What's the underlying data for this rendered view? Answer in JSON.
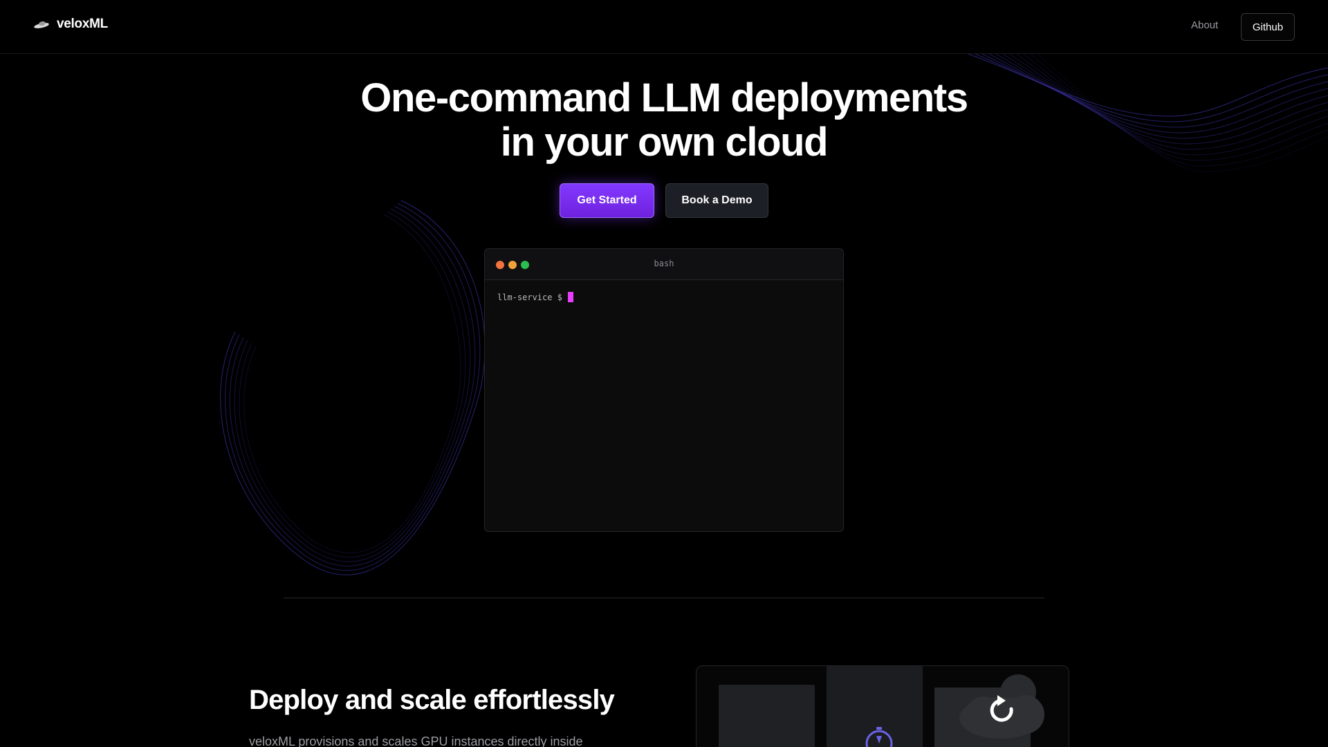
{
  "brand": {
    "name": "veloxML",
    "logo_icon": "flying-saucer-icon"
  },
  "nav": {
    "about_label": "About",
    "github_label": "Github"
  },
  "hero": {
    "title_line1": "One-command LLM deployments",
    "title_line2": "in your own cloud",
    "cta_primary": "Get Started",
    "cta_secondary": "Book a Demo"
  },
  "terminal": {
    "title": "bash",
    "prompt": "llm-service $",
    "window_controls": [
      "close-dot",
      "minimize-dot",
      "maximize-dot"
    ]
  },
  "feature": {
    "title": "Deploy and scale effortlessly",
    "description": "veloxML provisions and scales GPU instances directly inside"
  },
  "colors": {
    "background": "#000000",
    "accent": "#7b2ff7",
    "cursor": "#e83cff",
    "wave": "#4b3fd1",
    "dot_red": "#f2733f",
    "dot_yellow": "#f2a23a",
    "dot_green": "#2bbd4f"
  }
}
